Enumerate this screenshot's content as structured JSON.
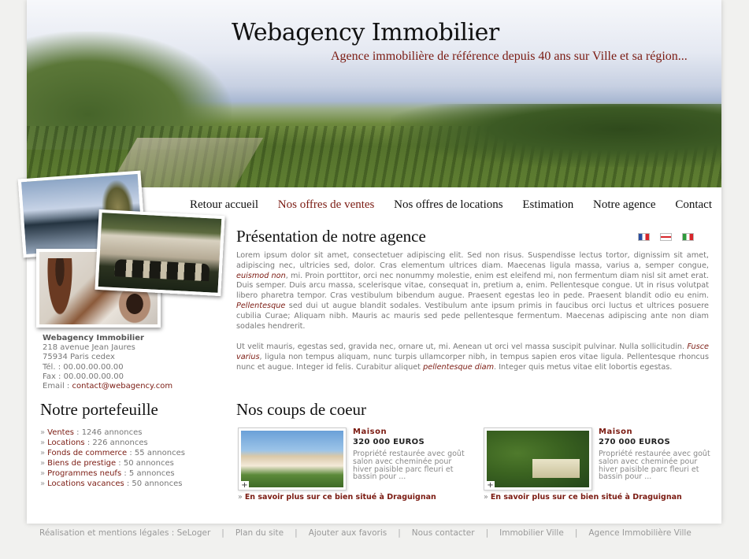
{
  "header": {
    "title": "Webagency Immobilier",
    "subtitle": "Agence immobilière de référence depuis 40 ans sur Ville et sa région..."
  },
  "nav": {
    "items": [
      "Retour accueil",
      "Nos offres de ventes",
      "Nos offres de locations",
      "Estimation",
      "Notre agence",
      "Contact"
    ],
    "active": "Nos offres de ventes"
  },
  "languages": [
    "fr",
    "en",
    "it"
  ],
  "contact": {
    "company": "Webagency Immobilier",
    "address": "218 avenue Jean Jaures",
    "city": "75934 Paris cedex",
    "tel": "Tél. : 00.00.00.00.00",
    "fax": "Fax : 00.00.00.00.00",
    "email_label": "Email : ",
    "email": "contact@webagency.com"
  },
  "portfolio": {
    "title": "Notre portefeuille",
    "items": [
      {
        "label": "Ventes",
        "count": " : 1246 annonces"
      },
      {
        "label": "Locations",
        "count": " : 226 annonces"
      },
      {
        "label": "Fonds de commerce",
        "count": " : 55 annonces"
      },
      {
        "label": "Biens de prestige",
        "count": " : 50 annonces"
      },
      {
        "label": "Programmes neufs",
        "count": " : 5 annonces"
      },
      {
        "label": "Locations vacances",
        "count": " : 50 annonces"
      }
    ]
  },
  "presentation": {
    "title": "Présentation de notre agence",
    "p1": [
      "Lorem ipsum dolor sit amet, consectetuer adipiscing elit. Sed non risus. Suspendisse lectus tortor, dignissim sit amet, adipiscing nec, ultricies sed, dolor. Cras elementum ultrices diam. Maecenas ligula massa, varius a, semper congue, ",
      "euismod non",
      ", mi. Proin porttitor, orci nec nonummy molestie, enim est eleifend mi, non fermentum diam nisl sit amet erat. Duis semper. Duis arcu massa, scelerisque vitae, consequat in, pretium a, enim. Pellentesque congue. Ut in risus volutpat libero pharetra tempor. Cras vestibulum bibendum augue. Praesent egestas leo in pede. Praesent blandit odio eu enim. ",
      "Pellentesque",
      " sed dui ut augue blandit sodales. Vestibulum ante ipsum primis in faucibus orci luctus et ultrices posuere cubilia Curae; Aliquam nibh. Mauris ac mauris sed pede pellentesque fermentum. Maecenas adipiscing ante non diam sodales hendrerit."
    ],
    "p2": [
      "Ut velit mauris, egestas sed, gravida nec, ornare ut, mi. Aenean ut orci vel massa suscipit pulvinar. Nulla sollicitudin. ",
      "Fusce varius",
      ", ligula non tempus aliquam, nunc turpis ullamcorper nibh, in tempus sapien eros vitae ligula. Pellentesque rhoncus nunc et augue. Integer id felis. Curabitur aliquet ",
      "pellentesque diam",
      ". Integer quis metus vitae elit lobortis egestas."
    ]
  },
  "favorites": {
    "title": "Nos coups de coeur",
    "items": [
      {
        "type": "Maison",
        "price": "320 000 EUROS",
        "description": "Propriété restaurée avec goût salon avec cheminée pour hiver paisible parc fleuri et bassin pour ...",
        "link": "En savoir plus sur ce bien situé à Draguignan"
      },
      {
        "type": "Maison",
        "price": "270 000 EUROS",
        "description": "Propriété restaurée avec goût salon avec cheminée pour hiver paisible parc fleuri et bassin pour ...",
        "link": "En savoir plus sur ce bien situé à Draguignan"
      }
    ]
  },
  "footer": {
    "links": [
      "Réalisation et mentions légales : SeLoger",
      "Plan du site",
      "Ajouter aux favoris",
      "Nous contacter",
      "Immobilier Ville",
      "Agence Immobilière Ville"
    ]
  },
  "colors": {
    "accent": "#7b1b12",
    "text": "#777777",
    "heading": "#111111"
  }
}
